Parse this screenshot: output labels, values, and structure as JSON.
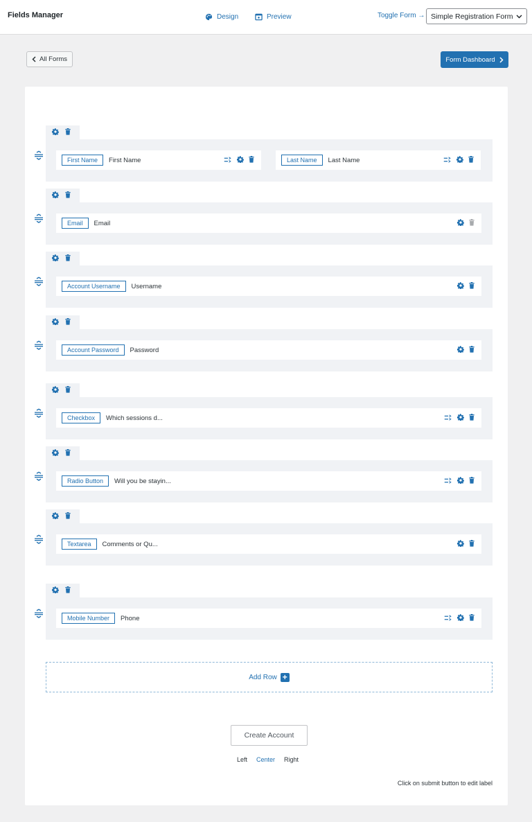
{
  "app": {
    "title": "Fields Manager",
    "design_label": "Design",
    "preview_label": "Preview",
    "toggle_form_label": "Toggle Form →",
    "selected_form": "Simple Registration Form"
  },
  "toolbar": {
    "all_forms_label": "All Forms",
    "dashboard_label": "Form Dashboard"
  },
  "rows": [
    {
      "fields": [
        {
          "tag": "First Name",
          "label": "First Name",
          "icons": [
            "conditional-logic-icon",
            "gear-icon",
            "trash-icon"
          ]
        },
        {
          "tag": "Last Name",
          "label": "Last Name",
          "icons": [
            "conditional-logic-icon",
            "gear-icon",
            "trash-icon"
          ]
        }
      ]
    },
    {
      "fields": [
        {
          "tag": "Email",
          "label": "Email",
          "icons": [
            "gear-icon",
            "trash-icon-disabled"
          ]
        }
      ]
    },
    {
      "fields": [
        {
          "tag": "Account Username",
          "label": "Username",
          "icons": [
            "gear-icon",
            "trash-icon"
          ]
        }
      ]
    },
    {
      "fields": [
        {
          "tag": "Account Password",
          "label": "Password",
          "icons": [
            "gear-icon",
            "trash-icon"
          ]
        }
      ]
    },
    {
      "fields": [
        {
          "tag": "Checkbox",
          "label": "Which sessions d...",
          "icons": [
            "conditional-logic-icon",
            "gear-icon",
            "trash-icon"
          ]
        }
      ]
    },
    {
      "fields": [
        {
          "tag": "Radio Button",
          "label": "Will you be stayin...",
          "icons": [
            "conditional-logic-icon",
            "gear-icon",
            "trash-icon"
          ]
        }
      ]
    },
    {
      "fields": [
        {
          "tag": "Textarea",
          "label": "Comments or Qu...",
          "icons": [
            "gear-icon",
            "trash-icon"
          ]
        }
      ]
    },
    {
      "fields": [
        {
          "tag": "Mobile Number",
          "label": "Phone",
          "icons": [
            "conditional-logic-icon",
            "gear-icon",
            "trash-icon"
          ]
        }
      ]
    }
  ],
  "add_row_label": "Add Row",
  "submit": {
    "label": "Create Account",
    "align_options": [
      "Left",
      "Center",
      "Right"
    ],
    "active_align": "Center",
    "hint": "Click on submit button to edit label"
  },
  "colors": {
    "accent": "#2271b1",
    "row_background": "#f0f2f5",
    "page_background": "#f0f0f1",
    "disabled_icon": "#a7aaad"
  }
}
